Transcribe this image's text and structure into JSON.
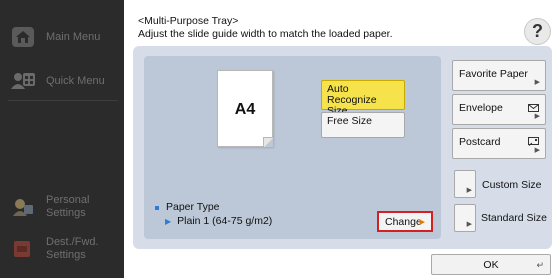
{
  "sidebar": {
    "items": [
      {
        "label_line1": "Main Menu",
        "label_line2": "",
        "icon": "home-icon"
      },
      {
        "label_line1": "Quick Menu",
        "label_line2": "",
        "icon": "quick-menu-icon"
      },
      {
        "label_line1": "Personal",
        "label_line2": "Settings",
        "icon": "personal-settings-icon"
      },
      {
        "label_line1": "Dest./Fwd.",
        "label_line2": "Settings",
        "icon": "dest-fwd-settings-icon"
      }
    ]
  },
  "header": {
    "title": "<Multi-Purpose Tray>",
    "instruction": "Adjust the slide guide width to match the loaded paper.",
    "help_label": "?"
  },
  "paper_preview": {
    "size_label": "A4"
  },
  "size_options": {
    "auto_recognize_line1": "Auto Recognize",
    "auto_recognize_line2": "Size",
    "free_size": "Free Size"
  },
  "paper_type": {
    "label": "Paper Type",
    "value": "Plain 1 (64-75 g/m2)",
    "change_label": "Change"
  },
  "right_buttons": {
    "favorite_paper": "Favorite Paper",
    "envelope": "Envelope",
    "postcard": "Postcard",
    "custom_size": "Custom Size",
    "standard_size": "Standard Size"
  },
  "footer": {
    "ok_label": "OK"
  },
  "colors": {
    "selected": "#f6e34c",
    "highlight_border": "#d42020",
    "accent": "#2f7cd6"
  }
}
